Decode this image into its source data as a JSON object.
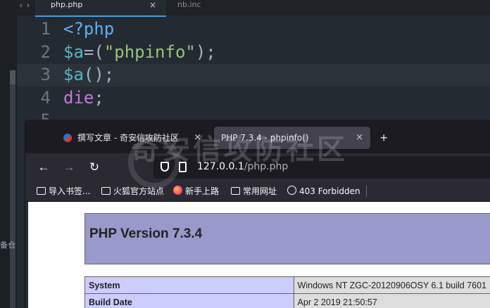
{
  "editor": {
    "side_text": "备仓",
    "tabs": [
      {
        "label": "php.php",
        "active": true
      },
      {
        "label": "nb.inc",
        "active": false
      }
    ],
    "lines": [
      {
        "num": "1",
        "tokens": [
          {
            "t": "<?php",
            "c": "tag"
          }
        ]
      },
      {
        "num": "2",
        "tokens": [
          {
            "t": "$a",
            "c": "var"
          },
          {
            "t": "=(",
            "c": "punc"
          },
          {
            "t": "\"phpinfo\"",
            "c": "str"
          },
          {
            "t": ");",
            "c": "punc"
          }
        ]
      },
      {
        "num": "3",
        "tokens": [
          {
            "t": "$a",
            "c": "var"
          },
          {
            "t": "();",
            "c": "punc"
          }
        ]
      },
      {
        "num": "4",
        "tokens": [
          {
            "t": "die",
            "c": "kw"
          },
          {
            "t": ";",
            "c": "punc"
          }
        ]
      },
      {
        "num": "5",
        "tokens": []
      }
    ],
    "active_line": 3
  },
  "browser": {
    "tabs": [
      {
        "label": "撰写文章 - 奇安信攻防社区",
        "active": false
      },
      {
        "label": "PHP 7.3.4 - phpinfo()",
        "active": true
      }
    ],
    "watermark": "奇安信攻防社区",
    "url": {
      "host": "127.0.0.1",
      "path": "/php.php"
    },
    "bookmarks": [
      {
        "label": "导入书签...",
        "icon": "import-icon"
      },
      {
        "label": "火狐官方站点",
        "icon": "folder-icon"
      },
      {
        "label": "新手上路",
        "icon": "firefox-icon"
      },
      {
        "label": "常用网址",
        "icon": "folder-icon"
      },
      {
        "label": "403 Forbidden",
        "icon": "globe-icon"
      }
    ],
    "page": {
      "title": "PHP Version 7.3.4",
      "rows": [
        {
          "key": "System",
          "value": "Windows NT ZGC-20120906OSY 6.1 build 7601"
        },
        {
          "key": "Build Date",
          "value": "Apr 2 2019 21:50:57"
        }
      ]
    }
  },
  "colors": {
    "php_header": "#9999cc",
    "php_key_cell": "#ccccff",
    "php_value_cell": "#dddddd",
    "editor_accent": "#4a9cd8"
  }
}
